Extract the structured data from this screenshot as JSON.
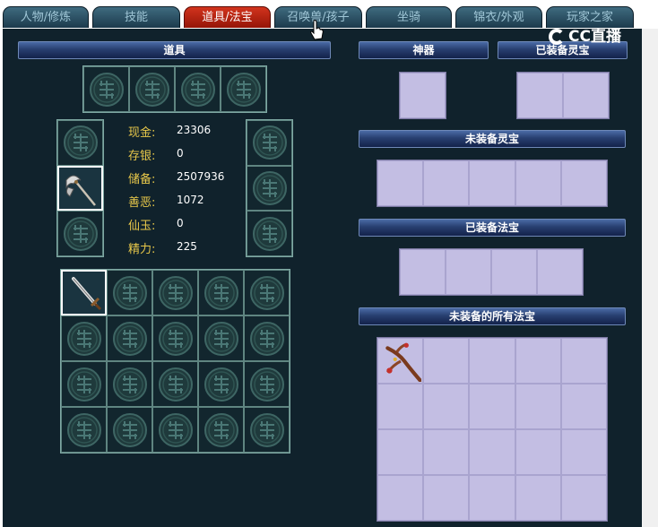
{
  "tabs": [
    {
      "label": "人物/修炼",
      "active": false
    },
    {
      "label": "技能",
      "active": false
    },
    {
      "label": "道具/法宝",
      "active": true
    },
    {
      "label": "召唤兽/孩子",
      "active": false
    },
    {
      "label": "坐骑",
      "active": false
    },
    {
      "label": "锦衣/外观",
      "active": false
    },
    {
      "label": "玩家之家",
      "active": false
    }
  ],
  "watermark": "CC直播",
  "left": {
    "header": "道具",
    "stats": [
      {
        "label": "现金:",
        "value": "23306"
      },
      {
        "label": "存银:",
        "value": "0"
      },
      {
        "label": "储备:",
        "value": "2507936"
      },
      {
        "label": "善恶:",
        "value": "1072"
      },
      {
        "label": "仙玉:",
        "value": "0"
      },
      {
        "label": "精力:",
        "value": "225"
      }
    ]
  },
  "right": {
    "artifact_header": "神器",
    "equipped_lingbao_header": "已装备灵宝",
    "unequipped_lingbao_header": "未装备灵宝",
    "equipped_fabao_header": "已装备法宝",
    "all_unequipped_fabao_header": "未装备的所有法宝"
  },
  "icons": {
    "empty_slot": "bronze-coin-icon",
    "weapon_slot": "halberd-icon",
    "inventory_first": "sword-icon",
    "fabao_first": "branch-staff-icon"
  },
  "colors": {
    "panel_bg": "#10222c",
    "header_blue": "#283f70",
    "active_tab": "#d2341d",
    "stat_label": "#e8c84a",
    "slot_lavender": "#c3bee3"
  }
}
